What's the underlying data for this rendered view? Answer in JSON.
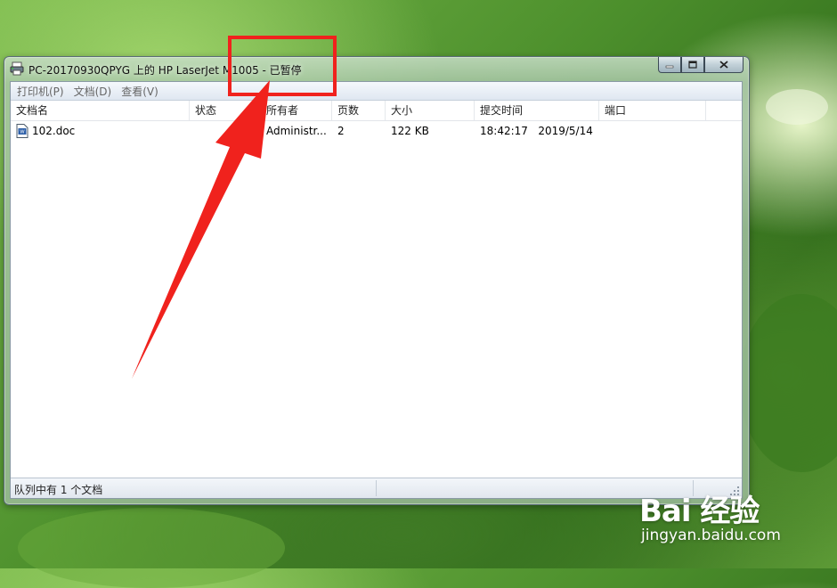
{
  "window": {
    "title": "PC-20170930QPYG 上的 HP LaserJet M1005 - 已暂停"
  },
  "menu": {
    "items": [
      {
        "label": "打印机(P)"
      },
      {
        "label": "文档(D)"
      },
      {
        "label": "查看(V)"
      }
    ]
  },
  "columns": [
    {
      "label": "文档名"
    },
    {
      "label": "状态"
    },
    {
      "label": "所有者"
    },
    {
      "label": "页数"
    },
    {
      "label": "大小"
    },
    {
      "label": "提交时间"
    },
    {
      "label": "端口"
    }
  ],
  "jobs": [
    {
      "document": "102.doc",
      "status": "",
      "owner": "Administr...",
      "pages": "2",
      "size": "122 KB",
      "submitted": "18:42:17   2019/5/14",
      "port": ""
    }
  ],
  "statusbar": {
    "text": "队列中有 1 个文档"
  },
  "annotation": {
    "color": "#f0221d"
  },
  "watermark": {
    "logo": "Bai 经验",
    "url": "jingyan.baidu.com"
  }
}
